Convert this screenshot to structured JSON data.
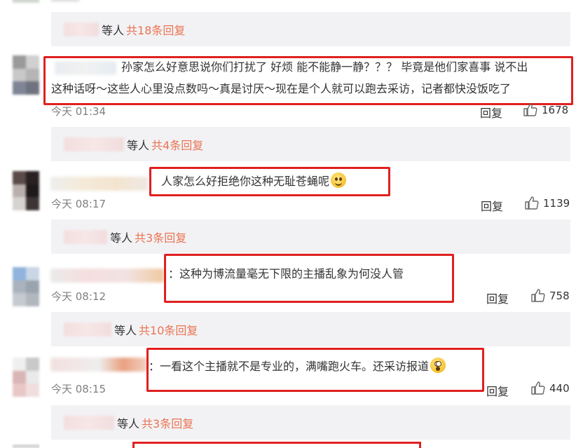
{
  "comments": [
    {
      "text_line1": "孙家怎么好意思说你们打扰了  好烦  能不能静一静？？？ 毕竟是他们家喜事  说不出",
      "text_line2": "这种话呀～这些人心里没点数吗～真是讨厌～现在是个人就可以跑去采访，记者都快没饭吃了",
      "time": "今天 01:34",
      "reply_label": "回复",
      "likes": "1678",
      "reply_bar": {
        "suffix": "等人",
        "count": "共4条回复"
      }
    },
    {
      "text": "人家怎么好拒绝你这种无耻苍蝇呢",
      "time": "今天 08:17",
      "reply_label": "回复",
      "likes": "1139",
      "reply_bar": {
        "suffix": "等人",
        "count": "共3条回复"
      }
    },
    {
      "prefix": "：",
      "text": "这种为博流量毫无下限的主播乱象为何没人管",
      "time": "今天 08:12",
      "reply_label": "回复",
      "likes": "758",
      "reply_bar": {
        "suffix": "等人",
        "count": "共10条回复"
      }
    },
    {
      "prefix": "：",
      "text": "一看这个主播就不是专业的，满嘴跑火车。还采访报道",
      "time": "今天 08:15",
      "reply_label": "回复",
      "likes": "440",
      "reply_bar": {
        "suffix": "等人",
        "count": "共3条回复"
      }
    }
  ],
  "top_reply_bar": {
    "suffix": "等人",
    "count": "共18条回复"
  },
  "icons": {
    "like": "thumbs-up-icon",
    "smile_emoji": "smile-emoji-icon",
    "shock_emoji": "shocked-emoji-icon"
  },
  "colors": {
    "highlight_box": "#e02020",
    "reply_count": "#eb7350",
    "reply_bar_bg": "#f2f2f5"
  }
}
